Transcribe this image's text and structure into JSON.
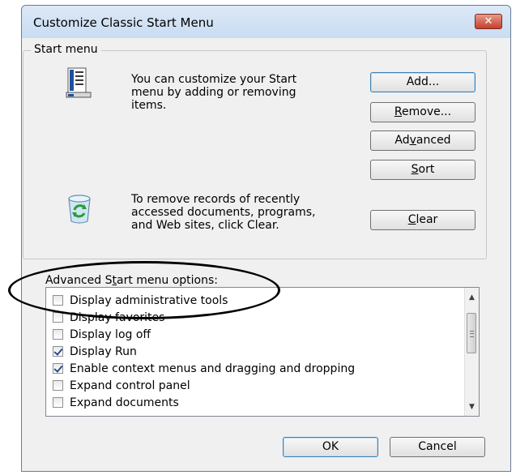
{
  "window": {
    "title": "Customize Classic Start Menu",
    "close_label": "✕"
  },
  "start_menu_group": {
    "label": "Start menu",
    "customize_text": [
      "You can customize your Start",
      "menu by adding or removing",
      "items."
    ],
    "clear_text": [
      "To remove records of recently",
      "accessed documents, programs,",
      "and Web sites, click Clear."
    ],
    "buttons": {
      "add": "Add...",
      "remove_pre": "",
      "remove_u": "R",
      "remove_post": "emove...",
      "advanced_pre": "Ad",
      "advanced_u": "v",
      "advanced_post": "anced",
      "sort_pre": "",
      "sort_u": "S",
      "sort_post": "ort",
      "clear_pre": "",
      "clear_u": "C",
      "clear_post": "lear"
    }
  },
  "advanced_options": {
    "label_pre": "Advanced S",
    "label_u": "t",
    "label_post": "art menu options:",
    "items": [
      {
        "label": "Display administrative tools",
        "checked": false
      },
      {
        "label": "Display favorites",
        "checked": false
      },
      {
        "label": "Display log off",
        "checked": false
      },
      {
        "label": "Display Run",
        "checked": true
      },
      {
        "label": "Enable context menus and dragging and dropping",
        "checked": true
      },
      {
        "label": "Expand control panel",
        "checked": false
      },
      {
        "label": "Expand documents",
        "checked": false
      }
    ]
  },
  "footer": {
    "ok": "OK",
    "cancel": "Cancel"
  },
  "colors": {
    "highlight_ellipse": "#000000",
    "close_button": "#c4402c",
    "titlebar": "#dce9f7"
  }
}
